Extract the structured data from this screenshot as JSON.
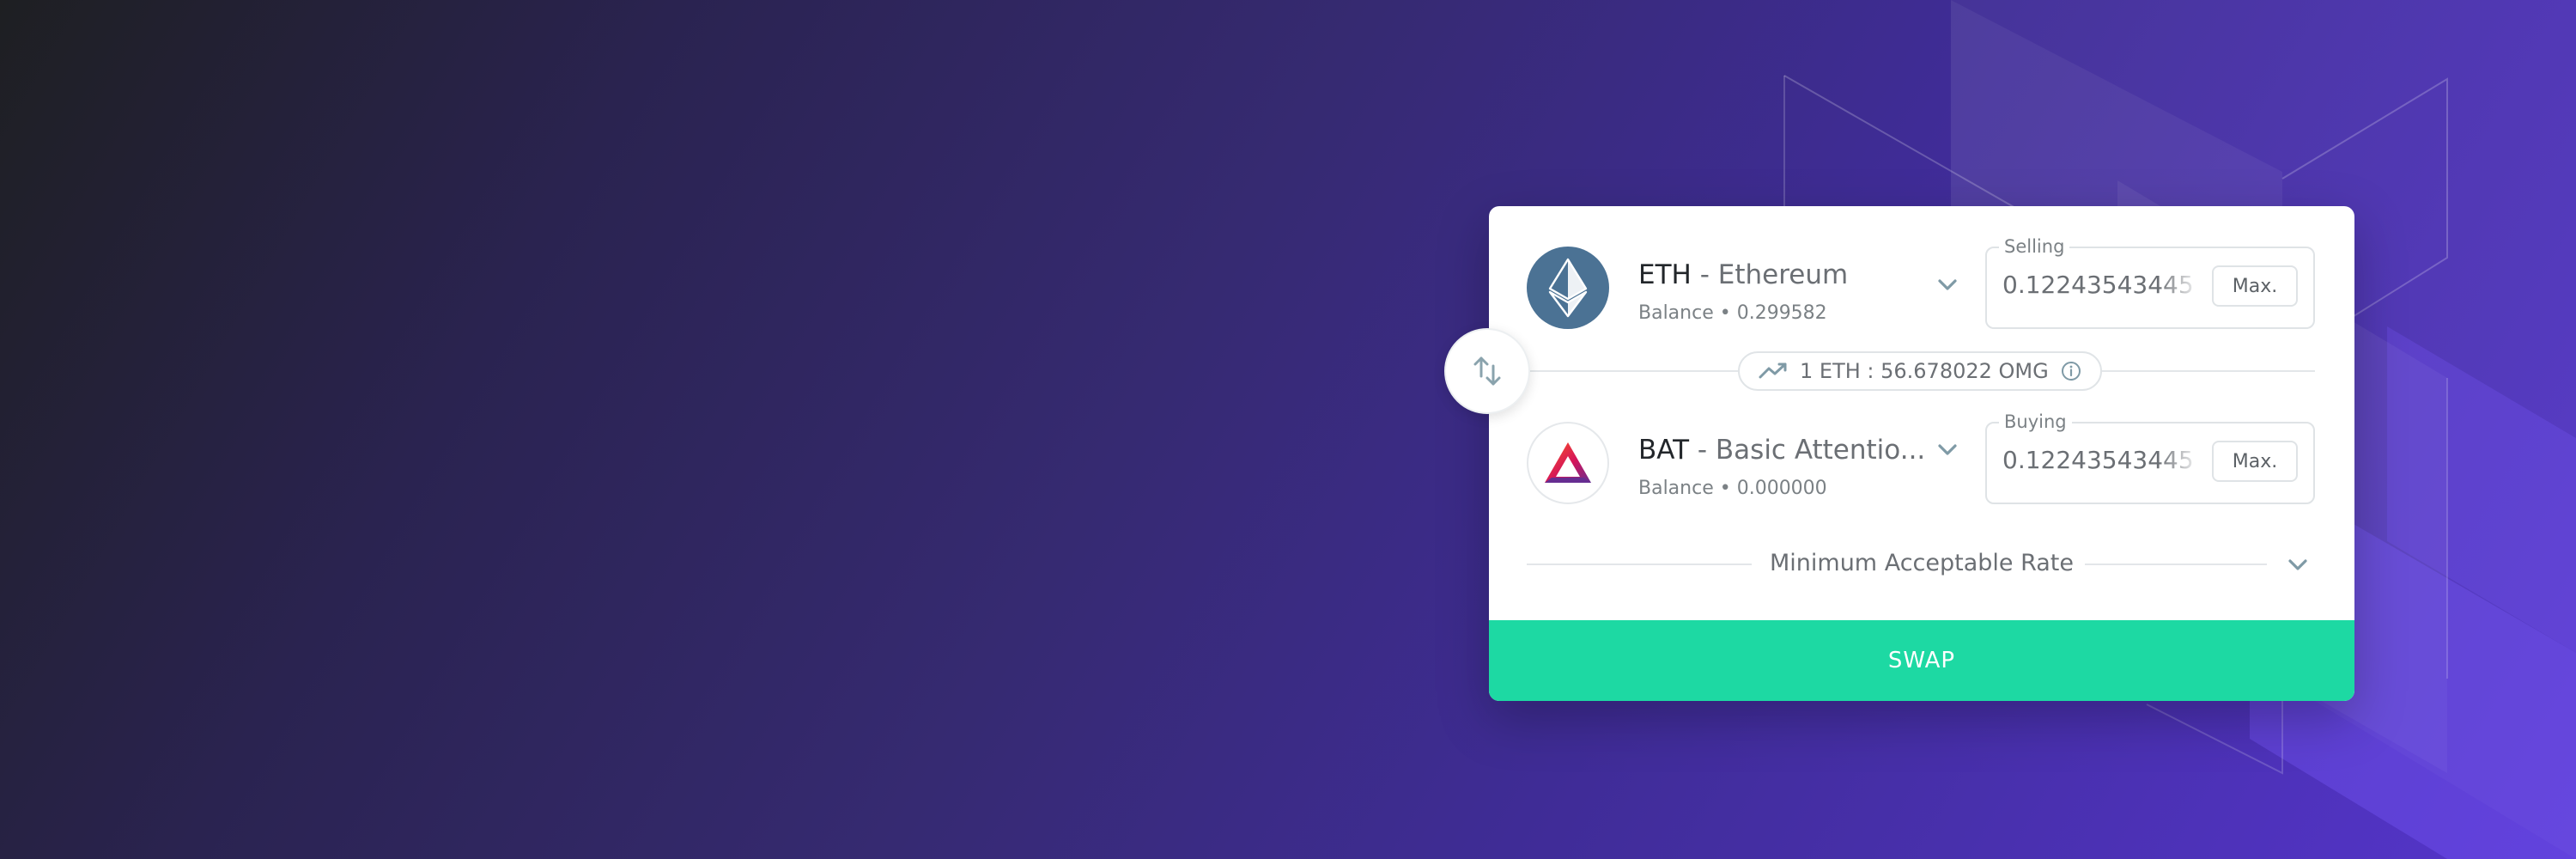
{
  "swap": {
    "sell": {
      "symbol": "ETH",
      "name_suffix": " - Ethereum",
      "balance": "Balance • 0.299582",
      "amount_label": "Selling",
      "amount_value": "0.12243543445",
      "max_label": "Max.",
      "icon": "ethereum-icon"
    },
    "rate": {
      "text": "1 ETH : 56.678022 OMG",
      "icon": "trend-icon",
      "info_icon": "info-icon"
    },
    "buy": {
      "symbol": "BAT",
      "name_suffix": " - Basic Attentio...",
      "balance": "Balance • 0.000000",
      "amount_label": "Buying",
      "amount_value": "0.12243543445",
      "max_label": "Max.",
      "icon": "bat-icon"
    },
    "min_rate_label": "Minimum Acceptable Rate",
    "swap_label": "SWAP",
    "switch_icon": "swap-arrows-icon"
  },
  "colors": {
    "accent": "#1dd9a3",
    "eth_circle": "#4b7294",
    "background_purple": "#5535cc"
  }
}
